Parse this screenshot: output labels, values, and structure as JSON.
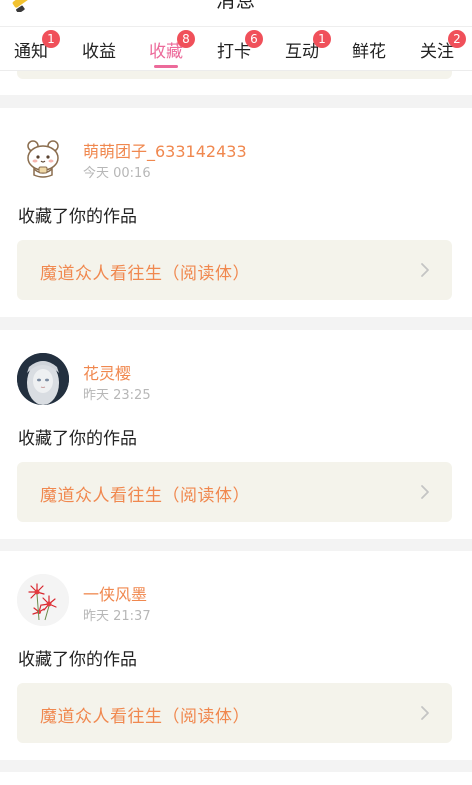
{
  "header": {
    "title": "消息",
    "pencil_icon": "pencil-icon"
  },
  "tabs": [
    {
      "label": "通知",
      "badge": "1",
      "active": false
    },
    {
      "label": "收益",
      "badge": "",
      "active": false
    },
    {
      "label": "收藏",
      "badge": "8",
      "active": true
    },
    {
      "label": "打卡",
      "badge": "6",
      "active": false
    },
    {
      "label": "互动",
      "badge": "1",
      "active": false
    },
    {
      "label": "鲜花",
      "badge": "",
      "active": false
    },
    {
      "label": "关注",
      "badge": "2",
      "active": false
    }
  ],
  "notifications": [
    {
      "username": "萌萌团子_633142433",
      "time": "今天 00:16",
      "action": "收藏了你的作品",
      "work_title": "魔道众人看往生（阅读体）",
      "avatar_icon": "cartoon-bear-avatar"
    },
    {
      "username": "花灵樱",
      "time": "昨天 23:25",
      "action": "收藏了你的作品",
      "work_title": "魔道众人看往生（阅读体）",
      "avatar_icon": "doll-photo-avatar"
    },
    {
      "username": "一侠风墨",
      "time": "昨天 21:37",
      "action": "收藏了你的作品",
      "work_title": "魔道众人看往生（阅读体）",
      "avatar_icon": "red-spider-lily-avatar"
    }
  ],
  "colors": {
    "accent_pink": "#ec6a9a",
    "badge_red": "#f0505a",
    "name_orange": "#f0884f",
    "card_block": "#f4f3eb"
  }
}
